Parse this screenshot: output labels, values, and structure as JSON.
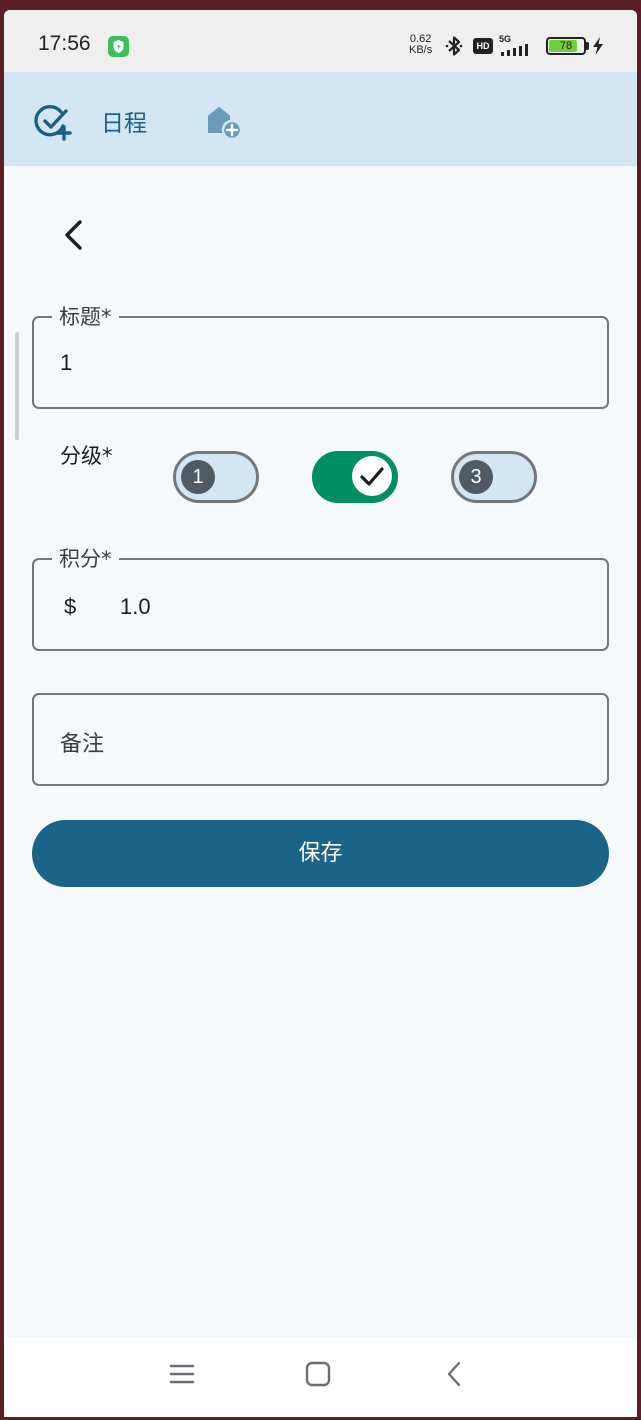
{
  "status_bar": {
    "time": "17:56",
    "net_speed_value": "0.62",
    "net_speed_unit": "KB/s",
    "hd_label": "HD",
    "network_label": "5G",
    "battery_level": "78",
    "battery_color": "#6fcf3c"
  },
  "app_bar": {
    "title": "日程",
    "left_icon": "schedule-add-icon",
    "right_icon": "home-add-icon",
    "background": "#d3e6f3"
  },
  "form": {
    "title_label": "标题*",
    "title_value": "1",
    "grade_label": "分级*",
    "grades": [
      {
        "label": "1",
        "selected": false
      },
      {
        "label": "",
        "selected": true
      },
      {
        "label": "3",
        "selected": false
      }
    ],
    "points_label": "积分*",
    "points_prefix": "$",
    "points_value": "1.0",
    "note_placeholder": "备注",
    "save_label": "保存",
    "accent_color": "#1a6488",
    "selected_color": "#008e63"
  },
  "nav_bar": {
    "icons": [
      "menu-icon",
      "home-icon",
      "back-icon"
    ]
  }
}
